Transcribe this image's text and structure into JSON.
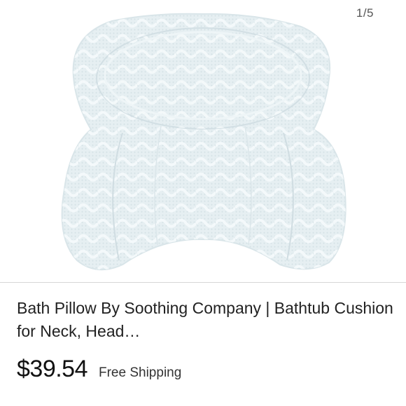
{
  "gallery": {
    "counter": "1/5",
    "image_icon": "bath-pillow-product-photo"
  },
  "listing": {
    "title": "Bath Pillow By Soothing Company | Bathtub Cushion for Neck, Head…",
    "price": "$39.54",
    "shipping": "Free Shipping"
  }
}
